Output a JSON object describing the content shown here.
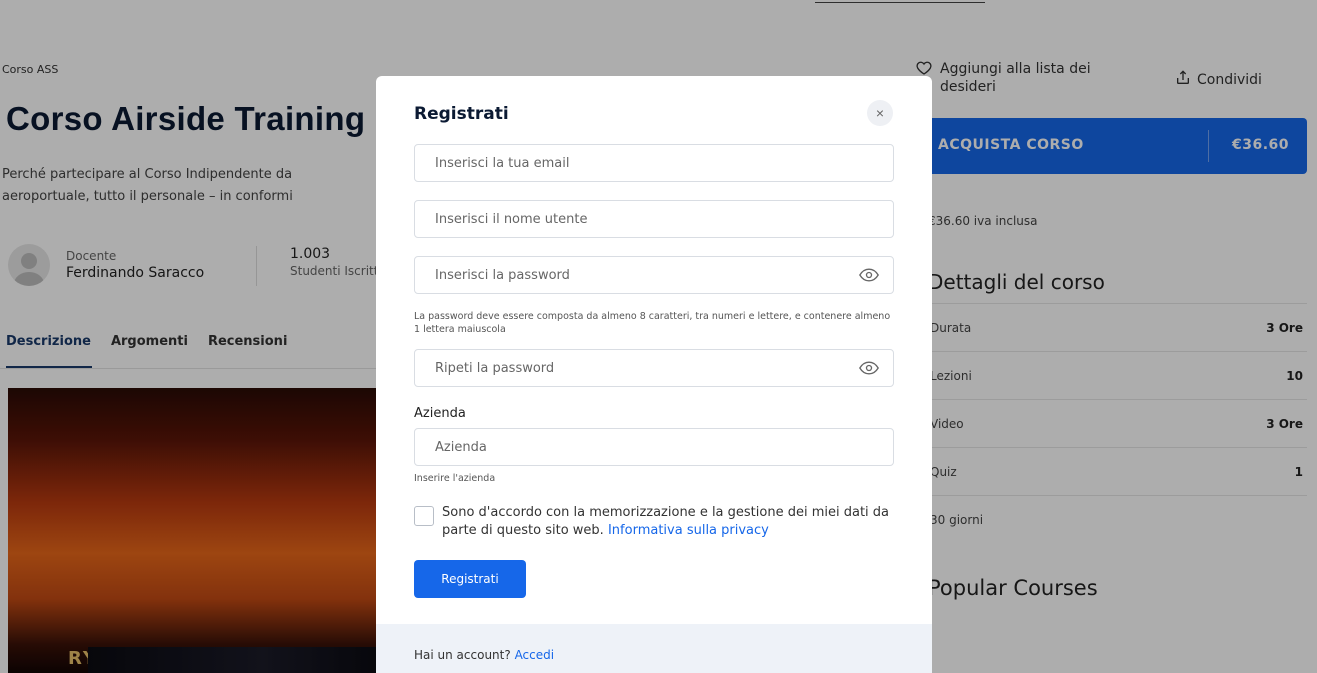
{
  "page": {
    "breadcrumb": "Corso ASS",
    "course_title": "Corso Airside Training",
    "description_line1": "Perché partecipare al Corso Indipendente da",
    "description_line2": "aeroportuale, tutto il personale – in conformi",
    "teacher_label": "Docente",
    "teacher_name": "Ferdinando Saracco",
    "students_count": "1.003",
    "students_label": "Studenti Iscritti",
    "tabs": [
      {
        "label": "Descrizione",
        "active": true
      },
      {
        "label": "Argomenti",
        "active": false
      },
      {
        "label": "Recensioni",
        "active": false
      }
    ],
    "hero_text": "RYANAIR",
    "wishlist_label": "Aggiungi alla lista dei desideri",
    "share_label": "Condividi",
    "buy_label": "ACQUISTA CORSO",
    "buy_price": "€36.60",
    "vat_text": "€36.60 iva inclusa",
    "details_title": "Dettagli del corso",
    "details": [
      {
        "label": "Durata",
        "value": "3 Ore"
      },
      {
        "label": "Lezioni",
        "value": "10"
      },
      {
        "label": "Video",
        "value": "3 Ore"
      },
      {
        "label": "Quiz",
        "value": "1"
      },
      {
        "label": "30 giorni",
        "value": ""
      }
    ],
    "popular_title": "Popular Courses"
  },
  "modal": {
    "title": "Registrati",
    "email_placeholder": "Inserisci la tua email",
    "username_placeholder": "Inserisci il nome utente",
    "password_placeholder": "Inserisci la password",
    "password_hint": "La password deve essere composta da almeno 8 caratteri, tra numeri e lettere, e contenere almeno 1 lettera maiuscola",
    "repeat_password_placeholder": "Ripeti la password",
    "company_label": "Azienda",
    "company_placeholder": "Azienda",
    "company_hint": "Inserire l'azienda",
    "consent_text": "Sono d'accordo con la memorizzazione e la gestione dei miei dati da parte di questo sito web.",
    "privacy_link": "Informativa sulla privacy",
    "submit_label": "Registrati",
    "footer_text": "Hai un account?",
    "login_link": "Accedi",
    "close_symbol": "×"
  },
  "colors": {
    "accent": "#1667e9",
    "title": "#0b1a33",
    "overlay": "rgba(0,0,0,0.32)"
  }
}
